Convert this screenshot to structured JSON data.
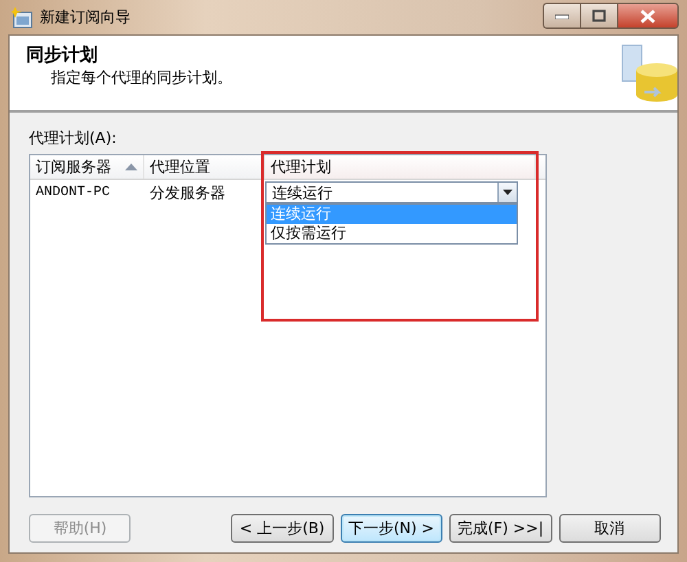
{
  "window": {
    "title": "新建订阅向导"
  },
  "header": {
    "title": "同步计划",
    "subtitle": "指定每个代理的同步计划。"
  },
  "grid": {
    "label": "代理计划(A):",
    "columns": [
      {
        "label": "订阅服务器",
        "sorted": true,
        "highlighted": false
      },
      {
        "label": "代理位置",
        "sorted": false,
        "highlighted": false
      },
      {
        "label": "代理计划",
        "sorted": false,
        "highlighted": true
      }
    ],
    "rows": [
      {
        "cells": [
          "ANDONT-PC",
          "分发服务器",
          "连续运行"
        ]
      }
    ],
    "dropdown": {
      "expanded": true,
      "options": [
        {
          "label": "连续运行",
          "selected": true
        },
        {
          "label": "仅按需运行",
          "selected": false
        }
      ]
    }
  },
  "buttons": [
    {
      "label": "帮助(H)",
      "disabled": true,
      "default": false
    },
    {
      "label": "< 上一步(B)",
      "disabled": false,
      "default": false
    },
    {
      "label": "下一步(N) >",
      "disabled": false,
      "default": true
    },
    {
      "label": "完成(F) >>|",
      "disabled": false,
      "default": false
    },
    {
      "label": "取消",
      "disabled": false,
      "default": false
    }
  ]
}
